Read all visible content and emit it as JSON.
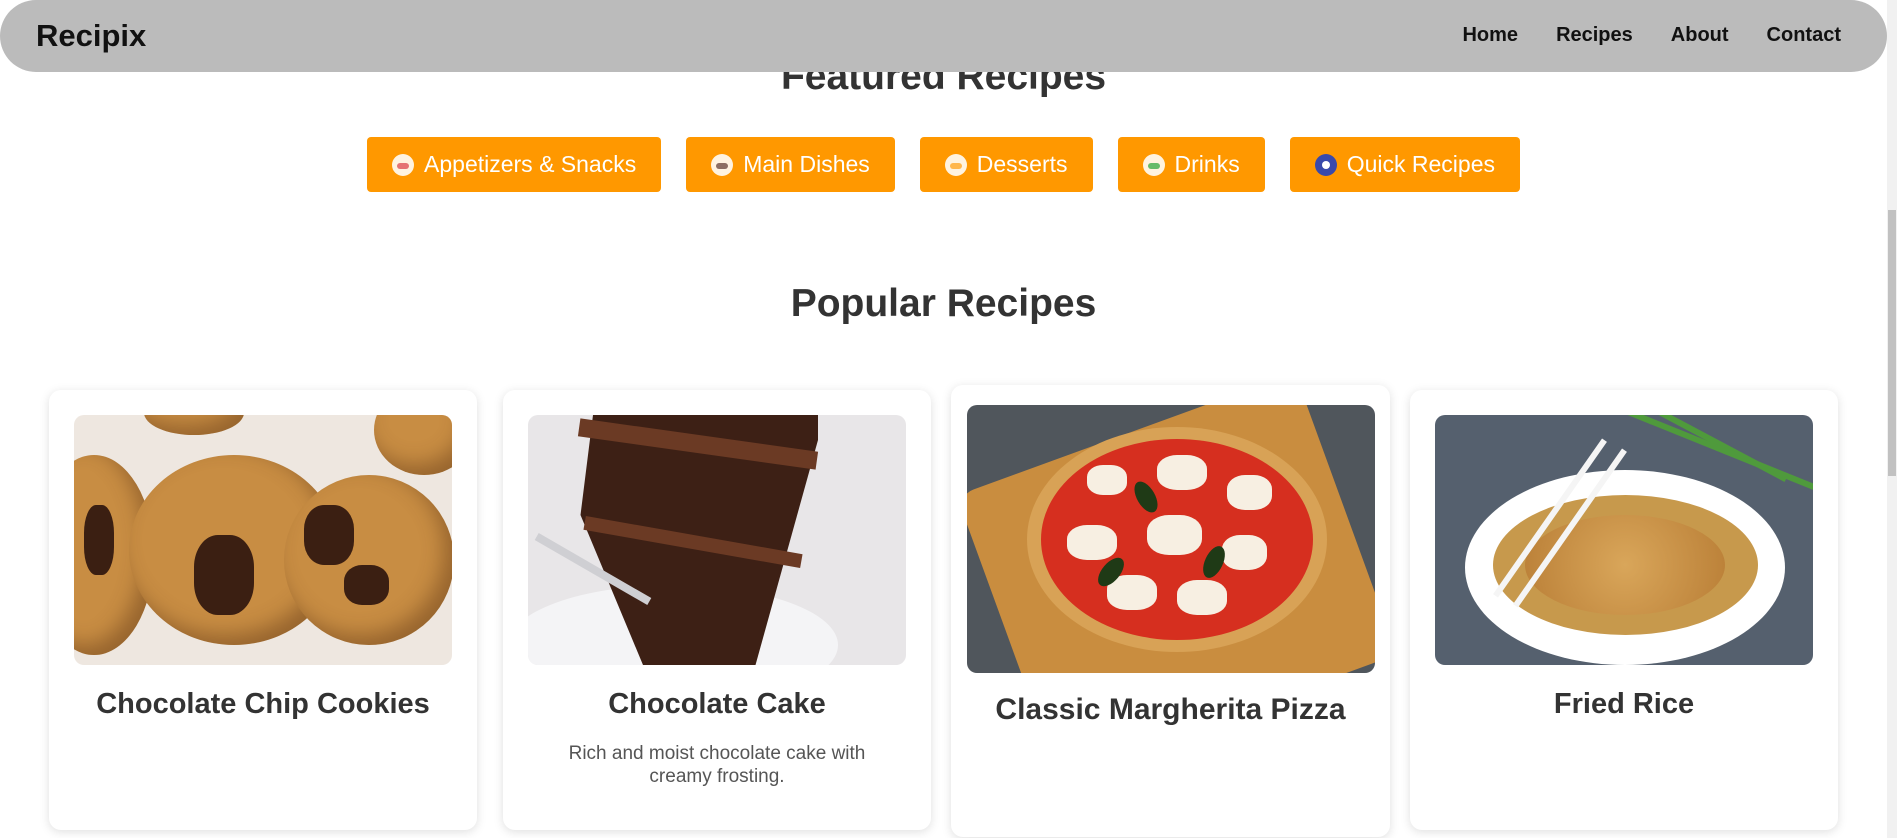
{
  "brand": "Recipix",
  "nav": [
    "Home",
    "Recipes",
    "About",
    "Contact"
  ],
  "featured": {
    "title": "Featured Recipes",
    "categories": [
      {
        "label": "Appetizers & Snacks",
        "icon": "appetizer-icon"
      },
      {
        "label": "Main Dishes",
        "icon": "main-dish-icon"
      },
      {
        "label": "Desserts",
        "icon": "cake-slice-icon"
      },
      {
        "label": "Drinks",
        "icon": "cocktail-icon"
      },
      {
        "label": "Quick Recipes",
        "icon": "stopwatch-icon"
      }
    ]
  },
  "popular": {
    "title": "Popular Recipes",
    "cards": [
      {
        "title": "Chocolate Chip Cookies",
        "description": ""
      },
      {
        "title": "Chocolate Cake",
        "description": "Rich and moist chocolate cake with creamy frosting."
      },
      {
        "title": "Classic Margherita Pizza",
        "description": ""
      },
      {
        "title": "Fried Rice",
        "description": ""
      }
    ]
  },
  "colors": {
    "accent": "#ff9800",
    "navbar": "#bbbbbb",
    "text": "#333333"
  }
}
